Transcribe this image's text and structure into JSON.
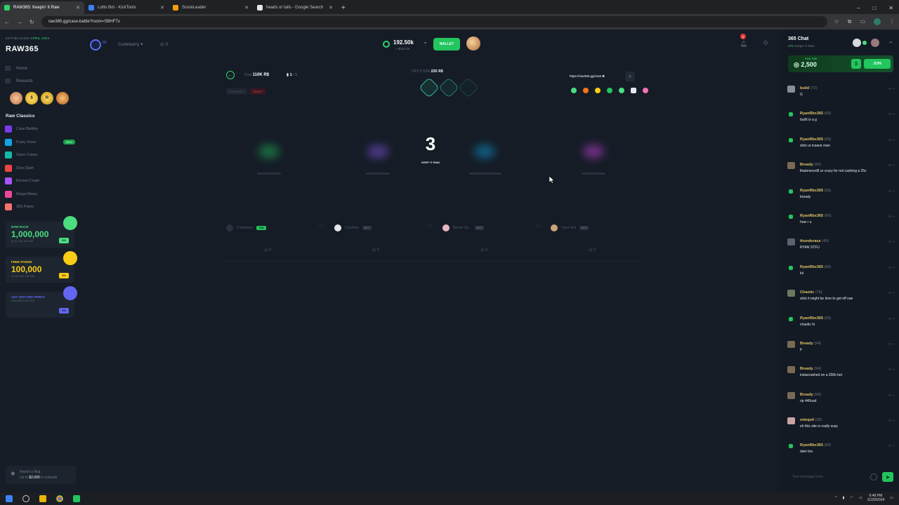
{
  "browser": {
    "tabs": [
      {
        "title": "RAW365: Keepin' It Raw",
        "active": true,
        "color": "#2fd36a"
      },
      {
        "title": "Lotto Bot - KickTools",
        "active": false,
        "color": "#3b82f6"
      },
      {
        "title": "ScoreLeader",
        "active": false,
        "color": "#f59e0b"
      },
      {
        "title": "heads or tails - Google Search",
        "active": false,
        "color": "#e5e7eb"
      }
    ],
    "new_tab": "+",
    "url": "raw365.gg/case-battle?room=SBHFTx"
  },
  "sidebar": {
    "established": "ESTABLISHED",
    "established_date": "APRIL 2024",
    "logo": "RAW365",
    "nav": [
      {
        "label": "Home",
        "icon": "home-icon"
      },
      {
        "label": "Rewards",
        "icon": "gift-icon"
      }
    ],
    "badges": [
      "",
      "$",
      "R",
      ""
    ],
    "section_title": "Raw Classics",
    "games": [
      {
        "label": "Case Battles",
        "color": "#7c3aed",
        "new": false
      },
      {
        "label": "Krazy Keno",
        "color": "#0ea5e9",
        "new": true
      },
      {
        "label": "Open Cases",
        "color": "#14b8a6",
        "new": false
      },
      {
        "label": "Dice Dash",
        "color": "#ef4444",
        "new": false
      },
      {
        "label": "Rocket Crash",
        "color": "#a855f7",
        "new": false
      },
      {
        "label": "Mega Mines",
        "color": "#ec4899",
        "new": false
      },
      {
        "label": "365 Poker",
        "color": "#f87171",
        "new": false
      }
    ],
    "new_label": "NEW",
    "promos": [
      {
        "title": "RAW RACE",
        "value": "1,000,000",
        "sub": "IN 1D 23H 16M 44S",
        "go": "GO",
        "color": "#4ade80"
      },
      {
        "title": "FREE POKER",
        "value": "100,000",
        "sub": "IN 13D 20H 41M 18S",
        "go": "GO",
        "color": "#facc15"
      },
      {
        "title": "GET DISCORD PERKS",
        "value": "",
        "sub": "DISCORD DISCORD",
        "go": "GO",
        "color": "#6366f1"
      }
    ],
    "bug_title": "Report a Bug",
    "bug_sub_prefix": "Up to ",
    "bug_amount": "$2,000",
    "bug_sub_suffix": " in rewards"
  },
  "topbar": {
    "level": "55",
    "username": "Codebarry",
    "points": "0",
    "balance": "192.50k",
    "balance_usd": "≈ $423.49",
    "wallet_label": "WALLET",
    "notif_count": "5"
  },
  "battle": {
    "cost_label": "Cost",
    "cost_value": "110K R$",
    "rounds_current": "1",
    "rounds_total": " / 5",
    "tag_left": "STANDARD",
    "tag_right": "CRAZY",
    "winnings_label": "OXY'S 10%",
    "winnings_value": "22K R$",
    "share_url": "https://raw365.gg/case",
    "countdown": "3",
    "countdown_sub": "KEEP IT RAW",
    "players": [
      {
        "name": "Codebarry",
        "tag": "YOU",
        "score": "0"
      },
      {
        "name": "Coodiam",
        "tag": "BOT",
        "score": "0"
      },
      {
        "name": "Bernie Sa...",
        "tag": "BOT",
        "score": "0"
      },
      {
        "name": "Vlaxx Bot",
        "tag": "BOT",
        "score": "0"
      }
    ]
  },
  "chat": {
    "title": "365 Chat",
    "online": "276",
    "online_label": " Keepin' It Raw",
    "rain_value": "2,500",
    "rain_sub": "RAIN TIME",
    "join_label": "JOIN",
    "messages": [
      {
        "user": "build",
        "level": "(72)",
        "text": "G",
        "av": "#8a8f96"
      },
      {
        "user": "RyanRbx365",
        "level": "(66)",
        "text": "build is a g",
        "av": "#22c55e"
      },
      {
        "user": "RyanRbx365",
        "level": "(66)",
        "text": "slick ur insane man",
        "av": "#22c55e"
      },
      {
        "user": "Bready",
        "level": "(94)",
        "text": "thatoneced6 ur crazy for not cashing a 25x",
        "av": "#7a6a55"
      },
      {
        "user": "RyanRbx365",
        "level": "(66)",
        "text": "bready",
        "av": "#22c55e"
      },
      {
        "user": "RyanRbx365",
        "level": "(66)",
        "text": "how r u",
        "av": "#22c55e"
      },
      {
        "user": "thunderass",
        "level": "(45)",
        "text": "RYAN STFU",
        "av": "#5a6470"
      },
      {
        "user": "RyanRbx365",
        "level": "(66)",
        "text": "lol",
        "av": "#22c55e"
      },
      {
        "user": "Chaotic",
        "level": "(78)",
        "text": "slick it might be time to get off raw",
        "av": "#6b7a5e"
      },
      {
        "user": "RyanRbx365",
        "level": "(66)",
        "text": "chaotic hi",
        "av": "#22c55e"
      },
      {
        "user": "Bready",
        "level": "(94)",
        "text": "fr",
        "av": "#7a6a55"
      },
      {
        "user": "Bready",
        "level": "(94)",
        "text": "instacrashed on a 200k bet",
        "av": "#7a6a55"
      },
      {
        "user": "Bready",
        "level": "(94)",
        "text": "rip 440usd",
        "av": "#7a6a55"
      },
      {
        "user": "retequ4",
        "level": "(38)",
        "text": "eh this site is really susy",
        "av": "#c9a3a3"
      },
      {
        "user": "RyanRbx365",
        "level": "(66)",
        "text": "dam bro",
        "av": "#22c55e"
      }
    ],
    "tip_label": "TIP",
    "input_placeholder": "Your message here...",
    "send_icon": "➤"
  },
  "taskbar": {
    "time": "6:48 PM",
    "date": "11/20/2024"
  }
}
